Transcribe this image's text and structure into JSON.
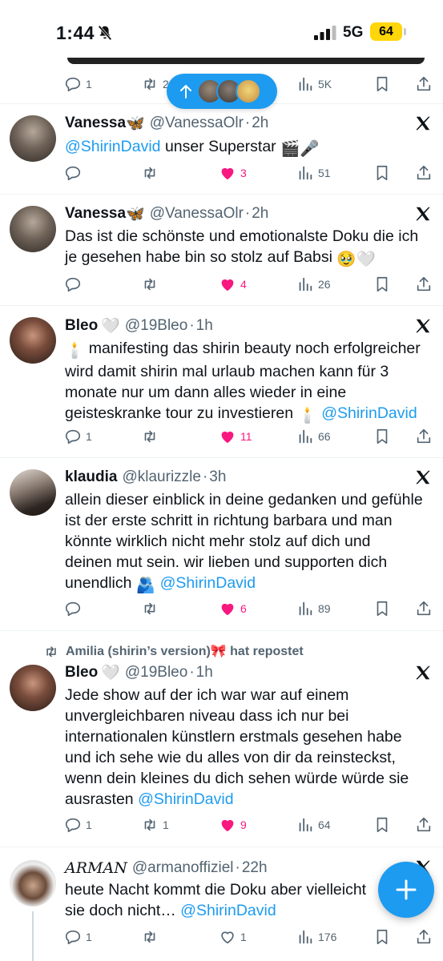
{
  "status_bar": {
    "time": "1:44",
    "network": "5G",
    "battery": "64"
  },
  "top_tweet_actions": {
    "replies": "1",
    "reposts": "2",
    "views": "5K"
  },
  "tweets": [
    {
      "name": "Vanessa",
      "name_emoji": "🦋",
      "handle": "@VanessaOlr",
      "time": "2h",
      "text": "unser Superstar",
      "mention": "@ShirinDavid",
      "emoji": "🎬🎤",
      "replies": "",
      "reposts": "",
      "likes": "3",
      "views": "51"
    },
    {
      "name": "Vanessa",
      "name_emoji": "🦋",
      "handle": "@VanessaOlr",
      "time": "2h",
      "text_line1": "Das ist die schönste und emotionalste Doku die ich",
      "text_line2": "je gesehen habe bin so stolz auf Babsi",
      "emoji": "🥹🤍",
      "replies": "",
      "reposts": "",
      "likes": "4",
      "views": "26"
    },
    {
      "name": "Bleo",
      "name_emoji": "🤍",
      "handle": "@19Bleo",
      "time": "1h",
      "candle": "🕯️",
      "text_line1": "manifesting das shirin beauty noch erfolgreicher",
      "text_line2": "wird damit shirin mal urlaub machen kann für 3",
      "text_line3": "monate nur um dann alles wieder in eine",
      "text_line4": "geisteskranke tour zu investieren",
      "mention": "@ShirinDavid",
      "replies": "1",
      "reposts": "",
      "likes": "11",
      "views": "66"
    },
    {
      "name": "klaudia",
      "handle": "@klaurizzle",
      "time": "3h",
      "text_line1": "allein dieser einblick in deine gedanken und gefühle",
      "text_line2": "ist der erste schritt in richtung barbara und man",
      "text_line3": "könnte wirklich nicht mehr stolz auf dich und",
      "text_line4": "deinen mut sein. wir lieben und supporten dich",
      "text_line5": "unendlich",
      "emoji": "🫂",
      "mention": "@ShirinDavid",
      "replies": "",
      "reposts": "",
      "likes": "6",
      "views": "89"
    },
    {
      "repost_context": "Amilia (shirin’s version)🎀 hat repostet",
      "name": "Bleo",
      "name_emoji": "🤍",
      "handle": "@19Bleo",
      "time": "1h",
      "text_line1": "Jede show auf der ich war war auf einem",
      "text_line2": "unvergleichbaren niveau dass ich nur bei",
      "text_line3": "internationalen künstlern erstmals gesehen habe",
      "text_line4": "und ich sehe wie du alles von dir da reinsteckst,",
      "text_line5": "wenn dein kleines du dich sehen würde würde sie",
      "text_line6": "ausrasten",
      "mention": "@ShirinDavid",
      "replies": "1",
      "reposts": "1",
      "likes": "9",
      "views": "64"
    },
    {
      "name": "𝐴𝑅𝑀𝐴𝑁",
      "handle": "@armanoffiziel",
      "time": "22h",
      "text_line1": "heute Nacht kommt die Doku aber vielleicht",
      "text_line2": "sie doch nicht…",
      "mention": "@ShirinDavid",
      "replies": "1",
      "reposts": "",
      "likes": "1",
      "views": "176"
    }
  ],
  "separator": "·",
  "colors": {
    "accent": "#1d9bf0",
    "like": "#f91880",
    "muted": "#536471",
    "battery": "#ffd60a"
  }
}
